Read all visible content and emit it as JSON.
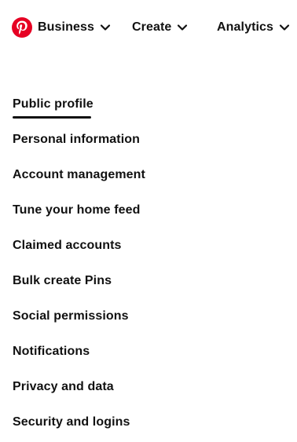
{
  "brand": {
    "logo_icon": "pinterest-logo-icon",
    "color": "#E60023"
  },
  "topnav": {
    "items": [
      {
        "label": "Business",
        "icon": "chevron-down-icon"
      },
      {
        "label": "Create",
        "icon": "chevron-down-icon"
      },
      {
        "label": "Analytics",
        "icon": "chevron-down-icon"
      }
    ]
  },
  "settings_menu": {
    "active_index": 0,
    "items": [
      {
        "label": "Public profile"
      },
      {
        "label": "Personal information"
      },
      {
        "label": "Account management"
      },
      {
        "label": "Tune your home feed"
      },
      {
        "label": "Claimed accounts"
      },
      {
        "label": "Bulk create Pins"
      },
      {
        "label": "Social permissions"
      },
      {
        "label": "Notifications"
      },
      {
        "label": "Privacy and data"
      },
      {
        "label": "Security and logins"
      }
    ]
  }
}
